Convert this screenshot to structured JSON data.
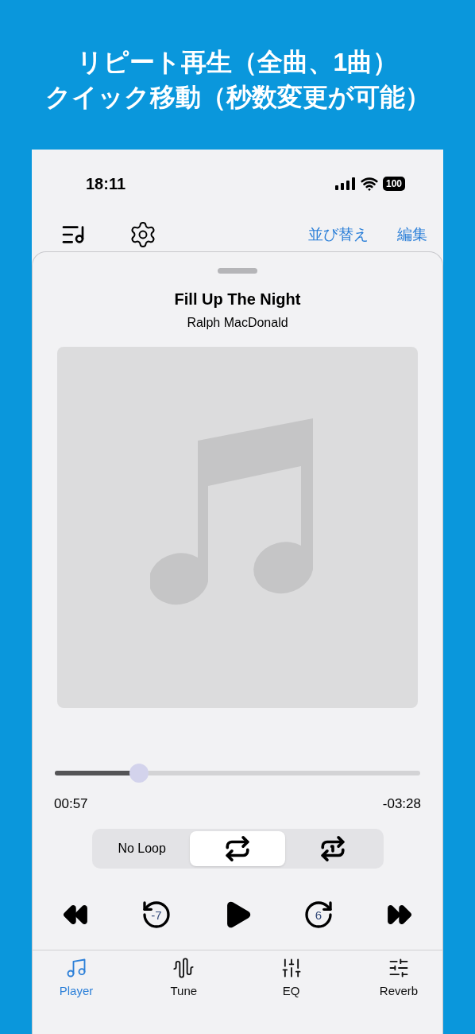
{
  "headline": [
    "リピート再生（全曲、1曲）",
    "クイック移動（秒数変更が可能）"
  ],
  "status_bar": {
    "time": "18:11",
    "battery": "100"
  },
  "toolbar": {
    "actions": [
      "並び替え",
      "編集"
    ]
  },
  "now_playing": {
    "title": "Fill Up The Night",
    "artist": "Ralph MacDonald",
    "progress": {
      "level": 0.23
    },
    "elapsed": "00:57",
    "remaining": "-03:28"
  },
  "loop_modes": [
    {
      "kind": "text",
      "label": "No Loop",
      "selected": false
    },
    {
      "kind": "repeat_all",
      "selected": true
    },
    {
      "kind": "repeat_one",
      "selected": false
    }
  ],
  "transport": [
    {
      "kind": "rewind"
    },
    {
      "kind": "skip_back",
      "label": "-7"
    },
    {
      "kind": "play"
    },
    {
      "kind": "skip_forward",
      "label": "6"
    },
    {
      "kind": "fast_forward"
    }
  ],
  "tabs": [
    {
      "kind": "music",
      "label": "Player",
      "selected": true
    },
    {
      "kind": "waveform",
      "label": "Tune",
      "selected": false
    },
    {
      "kind": "eq",
      "label": "EQ",
      "selected": false
    },
    {
      "kind": "sliders",
      "label": "Reverb",
      "selected": false
    }
  ]
}
